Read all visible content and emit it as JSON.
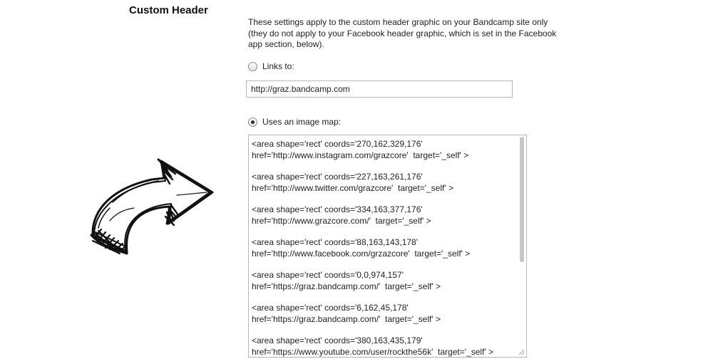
{
  "section": {
    "title": "Custom Header",
    "description": "These settings apply to the custom header graphic on your Bandcamp site only (they do not apply to your Facebook header graphic, which is set in the Facebook app section, below)."
  },
  "links_option": {
    "label": "Links to:",
    "selected": false,
    "url_value": "http://graz.bandcamp.com"
  },
  "image_map_option": {
    "label": "Uses an image map:",
    "selected": true,
    "areas": [
      {
        "line1": "<area shape='rect' coords='270,162,329,176'",
        "line2": "href='http://www.instagram.com/grazcore'  target='_self' >"
      },
      {
        "line1": "<area shape='rect' coords='227,163,261,176'",
        "line2": "href='http://www.twitter.com/grazcore'  target='_self' >"
      },
      {
        "line1": "<area shape='rect' coords='334,163,377,176'",
        "line2": "href='http://www.grazcore.com/'  target='_self' >"
      },
      {
        "line1": "<area shape='rect' coords='88,163,143,178'",
        "line2": "href='http://www.facebook.com/grzazcore'  target='_self' >"
      },
      {
        "line1": "<area shape='rect' coords='0,0,974,157'",
        "line2": "href='https://graz.bandcamp.com/'  target='_self' >"
      },
      {
        "line1": "<area shape='rect' coords='6,162,45,178'",
        "line2": "href='https://graz.bandcamp.com/'  target='_self' >"
      },
      {
        "line1": "<area shape='rect' coords='380,163,435,179'",
        "line2": "href='https://www.youtube.com/user/rockthe56k'  target='_self' >"
      }
    ]
  },
  "decoration": {
    "arrow_icon": "hand-drawn-arrow-icon"
  }
}
